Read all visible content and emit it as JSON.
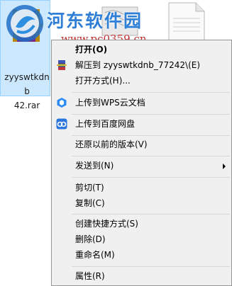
{
  "file": {
    "name": "zyyswtkdnb_77242.rar",
    "name_display_line1": "zyyswtkdnb",
    "name_display_line2": "42.rar",
    "icon": "winrar-archive-icon"
  },
  "watermark": {
    "brand": "河东软件园",
    "domain": "www.pc0359.cn"
  },
  "context_menu": {
    "items": [
      {
        "label": "打开(O)",
        "bold": true,
        "icon": null
      },
      {
        "label": "解压到 zyyswtkdnb_77242\\(E)",
        "icon": "winrar-extract-icon"
      },
      {
        "label": "打开方式(H)...",
        "icon": null
      },
      {
        "label": "上传到WPS云文档",
        "icon": "wps-cloud-icon"
      },
      {
        "label": "上传到百度网盘",
        "icon": "baidu-netdisk-icon"
      },
      {
        "label": "还原以前的版本(V)",
        "icon": null
      },
      {
        "label": "发送到(N)",
        "icon": null,
        "submenu": true
      },
      {
        "label": "剪切(T)",
        "icon": null
      },
      {
        "label": "复制(C)",
        "icon": null
      },
      {
        "label": "创建快捷方式(S)",
        "icon": null
      },
      {
        "label": "删除(D)",
        "icon": null
      },
      {
        "label": "重命名(M)",
        "icon": null
      },
      {
        "label": "属性(R)",
        "icon": null
      }
    ]
  },
  "colors": {
    "selection_fill": "#cce8ff",
    "menu_background": "#f0f0f0",
    "wps_blue": "#2d8cf0",
    "baidu_blue": "#2a76e0"
  }
}
